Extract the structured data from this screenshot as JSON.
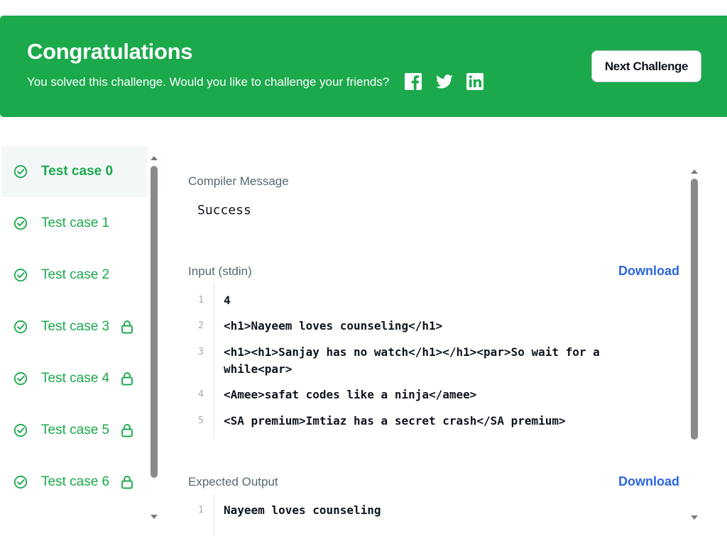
{
  "banner": {
    "title": "Congratulations",
    "subtitle": "You solved this challenge. Would you like to challenge your friends?",
    "next_label": "Next Challenge",
    "icons": [
      "facebook-icon",
      "twitter-icon",
      "linkedin-icon"
    ],
    "color": "#1ba94c"
  },
  "sidebar": {
    "items": [
      {
        "label": "Test case 0",
        "locked": false,
        "active": true
      },
      {
        "label": "Test case 1",
        "locked": false,
        "active": false
      },
      {
        "label": "Test case 2",
        "locked": false,
        "active": false
      },
      {
        "label": "Test case 3",
        "locked": true,
        "active": false
      },
      {
        "label": "Test case 4",
        "locked": true,
        "active": false
      },
      {
        "label": "Test case 5",
        "locked": true,
        "active": false
      },
      {
        "label": "Test case 6",
        "locked": true,
        "active": false
      }
    ]
  },
  "compiler": {
    "label": "Compiler Message",
    "message": "Success"
  },
  "input": {
    "label": "Input (stdin)",
    "download": "Download",
    "lines": [
      {
        "n": "1",
        "text": "4"
      },
      {
        "n": "2",
        "text": "<h1>Nayeem loves counseling</h1>"
      },
      {
        "n": "3",
        "text": "<h1><h1>Sanjay has no watch</h1></h1><par>So wait for a while<par>"
      },
      {
        "n": "4",
        "text": "<Amee>safat codes like a ninja</amee>"
      },
      {
        "n": "5",
        "text": "<SA premium>Imtiaz has a secret crash</SA premium>"
      }
    ]
  },
  "expected": {
    "label": "Expected Output",
    "download": "Download",
    "lines": [
      {
        "n": "1",
        "text": "Nayeem loves counseling"
      }
    ]
  },
  "colors": {
    "success": "#1ba94c",
    "link": "#2a66e2"
  }
}
